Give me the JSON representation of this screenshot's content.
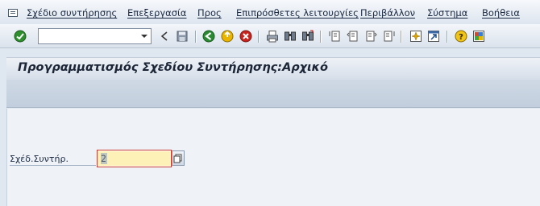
{
  "menu": {
    "items": [
      {
        "label": "Σχέδιο συντήρησης"
      },
      {
        "label": "Επεξεργασία"
      },
      {
        "label": "Προς"
      },
      {
        "label": "Επιπρόσθετες λειτουργίες"
      },
      {
        "label": "Περιβάλλον"
      },
      {
        "label": "Σύστημα"
      },
      {
        "label": "Βοήθεια"
      }
    ]
  },
  "toolbar": {
    "command_field_value": "",
    "icons": [
      "enter-icon",
      "back-arrow-icon",
      "save-icon",
      "back-icon",
      "exit-icon",
      "cancel-icon",
      "print-icon",
      "find-icon",
      "find-next-icon",
      "first-page-icon",
      "previous-page-icon",
      "next-page-icon",
      "last-page-icon",
      "new-session-icon",
      "shortcut-icon",
      "help-icon",
      "customize-layout-icon"
    ]
  },
  "page": {
    "title": "Προγραμματισμός Σχεδίου Συντήρησης:Αρχικό"
  },
  "form": {
    "field_label": "Σχέδ.Συντήρ.",
    "field_value": "2"
  },
  "colors": {
    "required_field_border": "#c93b2f",
    "input_background": "#fdf1b8"
  }
}
